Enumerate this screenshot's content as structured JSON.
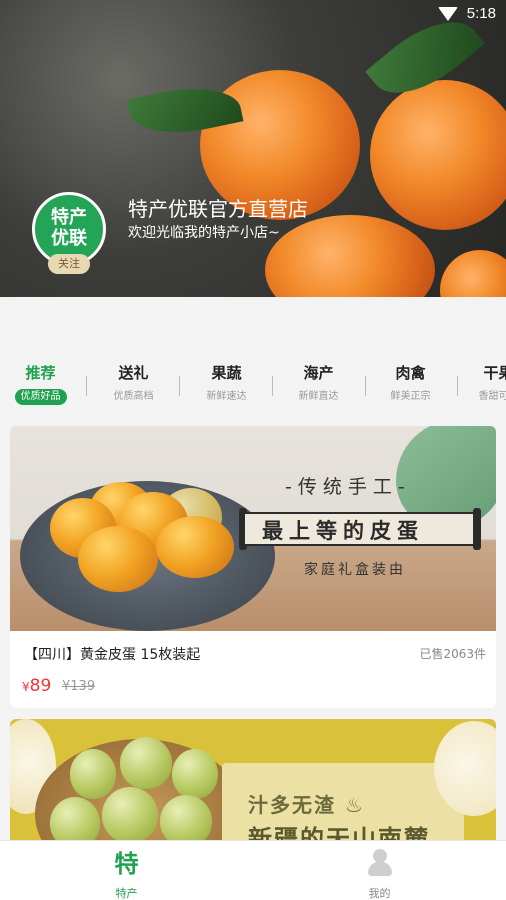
{
  "status_bar": {
    "time": "5:18"
  },
  "shop": {
    "logo_line1": "特产",
    "logo_line2": "优联",
    "follow_label": "关注",
    "name": "特产优联官方直营店",
    "description": "欢迎光临我的特产小店~"
  },
  "tabs": [
    {
      "label": "推荐",
      "sub": "优质好品",
      "active": true
    },
    {
      "label": "送礼",
      "sub": "优质高档"
    },
    {
      "label": "果蔬",
      "sub": "新鲜速达"
    },
    {
      "label": "海产",
      "sub": "新鲜直达"
    },
    {
      "label": "肉禽",
      "sub": "鲜美正宗"
    },
    {
      "label": "干果",
      "sub": "香甜可口"
    }
  ],
  "products": [
    {
      "banner_top": "-传统手工-",
      "banner_main": "最上等的皮蛋",
      "banner_bottom": "家庭礼盒装由",
      "title": "【四川】黄金皮蛋 15枚装起",
      "sold": "已售2063件",
      "currency": "¥",
      "price": "89",
      "original_price": "¥139"
    },
    {
      "banner_line1": "汁多无渣 ♨",
      "banner_line2": "新疆的天山南麓"
    }
  ],
  "bottom_nav": [
    {
      "icon": "te-logo-icon",
      "glyph": "特",
      "label": "特产",
      "active": true
    },
    {
      "icon": "profile-icon",
      "label": "我的",
      "active": false
    }
  ],
  "colors": {
    "accent": "#1fa14f",
    "price": "#f2343a",
    "follow_bg": "#e9d8b4"
  }
}
